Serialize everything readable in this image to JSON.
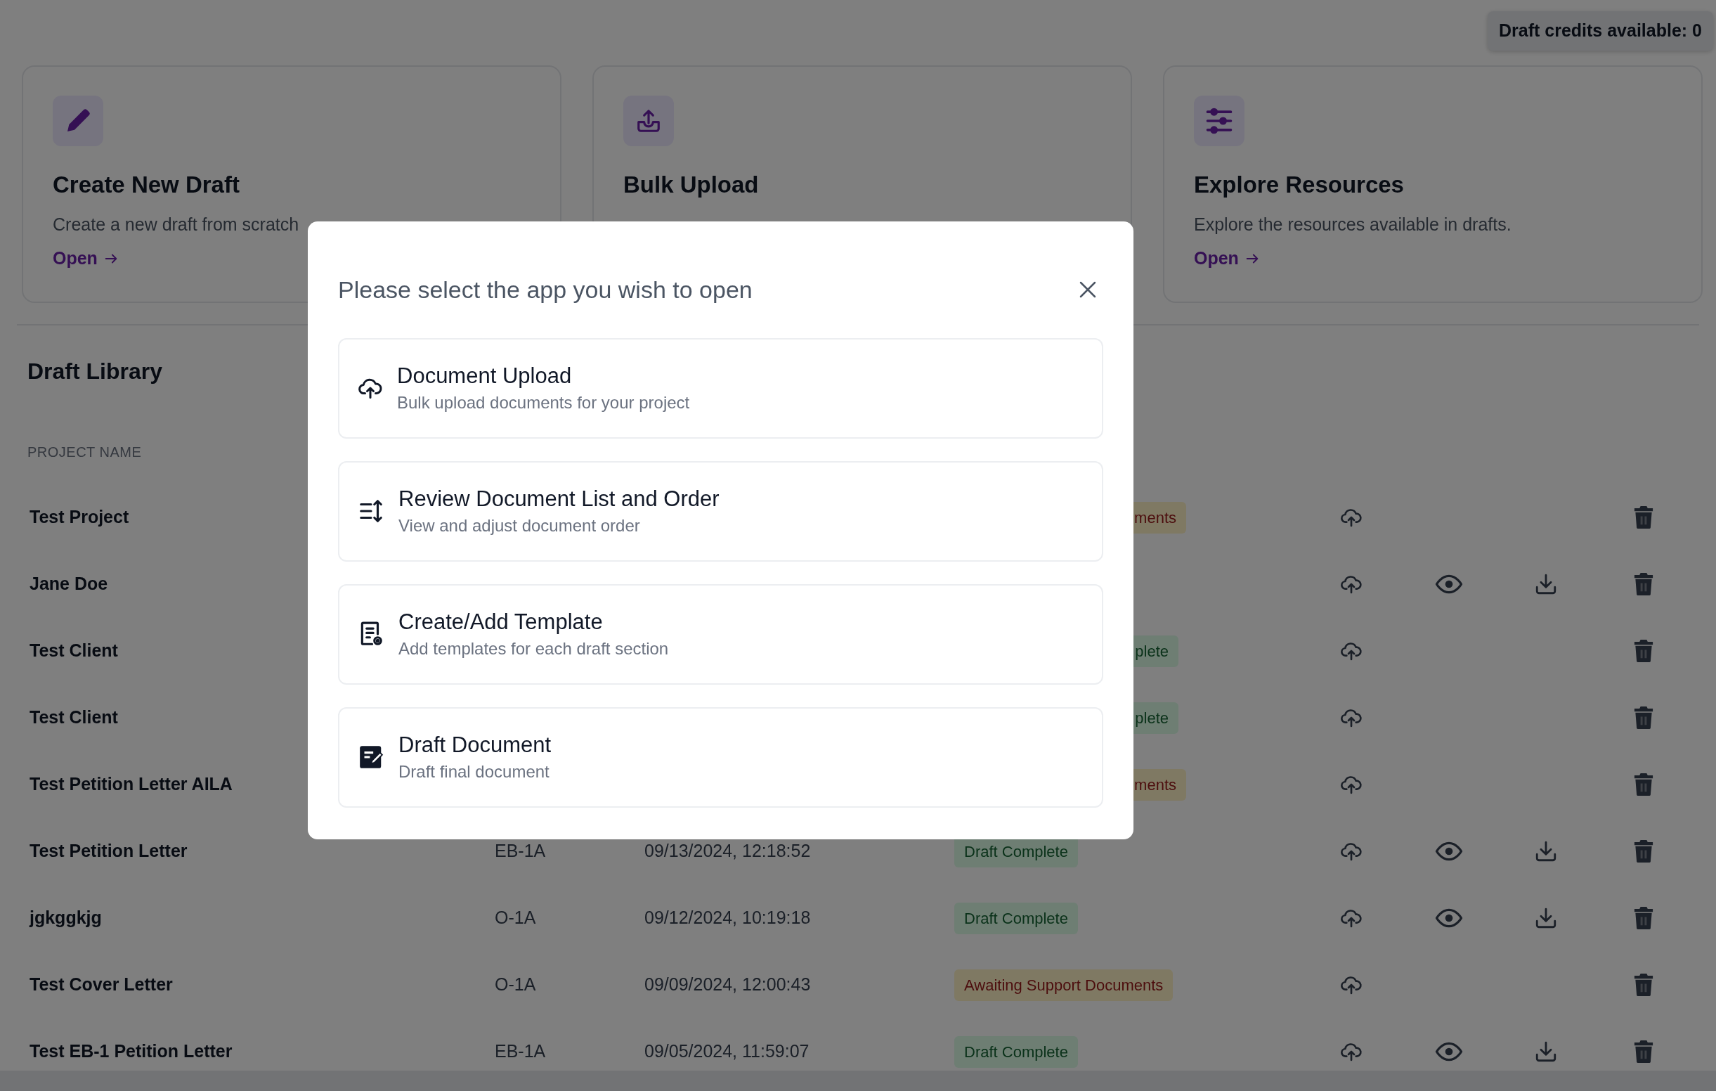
{
  "credits": "Draft credits available: 0",
  "cards": [
    {
      "title": "Create New Draft",
      "description": "Create a new draft from scratch",
      "link": "Open"
    },
    {
      "title": "Bulk Upload"
    },
    {
      "title": "Explore Resources",
      "description": "Explore the resources available in drafts.",
      "link": "Open"
    }
  ],
  "library": {
    "title": "Draft Library",
    "columns": [
      "PROJECT NAME"
    ],
    "rows": [
      {
        "name": "Test Project",
        "status": {
          "text": "ments",
          "kind": "warning",
          "cut": true
        },
        "viewable": false,
        "downloadable": false
      },
      {
        "name": "Jane Doe",
        "viewable": true,
        "downloadable": true
      },
      {
        "name": "Test Client",
        "status": {
          "text": "plete",
          "kind": "success",
          "cut": true
        },
        "viewable": false,
        "downloadable": false
      },
      {
        "name": "Test Client",
        "status": {
          "text": "plete",
          "kind": "success",
          "cut": true
        },
        "viewable": false,
        "downloadable": false
      },
      {
        "name": "Test Petition Letter AILA",
        "status": {
          "text": "ments",
          "kind": "warning",
          "cut": true
        },
        "viewable": false,
        "downloadable": false
      },
      {
        "name": "Test Petition Letter",
        "type": "EB-1A",
        "date": "09/13/2024, 12:18:52",
        "status": {
          "text": "Draft Complete",
          "kind": "success",
          "cut": false
        },
        "viewable": true,
        "downloadable": true
      },
      {
        "name": "jgkggkjg",
        "type": "O-1A",
        "date": "09/12/2024, 10:19:18",
        "status": {
          "text": "Draft Complete",
          "kind": "success",
          "cut": false
        },
        "viewable": true,
        "downloadable": true
      },
      {
        "name": "Test Cover Letter",
        "type": "O-1A",
        "date": "09/09/2024, 12:00:43",
        "status": {
          "text": "Awaiting Support Documents",
          "kind": "warning",
          "cut": false
        },
        "viewable": false,
        "downloadable": false
      },
      {
        "name": "Test EB-1 Petition Letter",
        "type": "EB-1A",
        "date": "09/05/2024, 11:59:07",
        "status": {
          "text": "Draft Complete",
          "kind": "success",
          "cut": false
        },
        "viewable": true,
        "downloadable": true
      }
    ]
  },
  "modal": {
    "title": "Please select the app you wish to open",
    "options": [
      {
        "title": "Document Upload",
        "subtitle": "Bulk upload documents for your project"
      },
      {
        "title": "Review Document List and Order",
        "subtitle": "View and adjust document order"
      },
      {
        "title": "Create/Add Template",
        "subtitle": "Add templates for each draft section"
      },
      {
        "title": "Draft Document",
        "subtitle": "Draft final document"
      }
    ]
  }
}
